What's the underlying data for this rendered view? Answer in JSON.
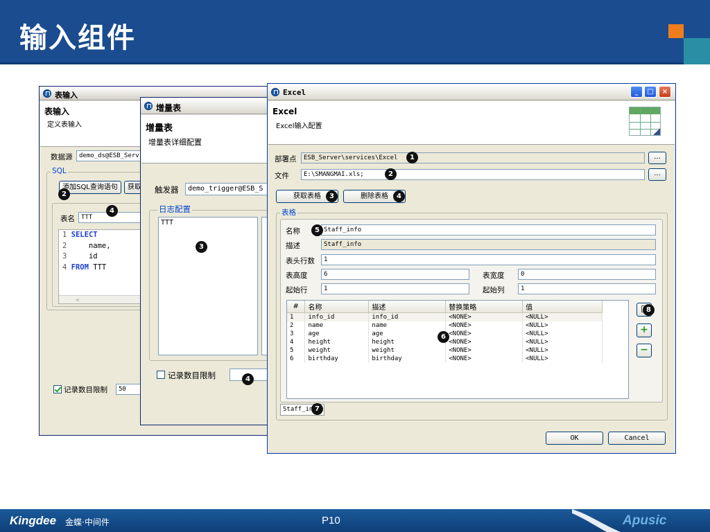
{
  "slide": {
    "title": "输入组件",
    "page": "P10",
    "footer_left_logo": "Kingdee",
    "footer_left_sub": "金蝶·中间件",
    "footer_right_logo": "Apusic"
  },
  "colors": {
    "header_bg": "#1a4c8f",
    "accent_orange": "#f07d1c",
    "accent_teal": "#2a8fa5",
    "badge": "#111111"
  },
  "table_input_window": {
    "title": "表输入",
    "header_title": "表输入",
    "header_desc": "定义表输入",
    "datasource_label": "数据源",
    "datasource_value": "demo_ds@ESB_Serv",
    "sql_group": "SQL",
    "add_sql_button": "添加SQL查询语句",
    "fetch_button": "获取",
    "table_name_label": "表名",
    "table_name_value": "TTT",
    "code_lines": [
      {
        "num": "1",
        "kw": "SELECT",
        "text": ""
      },
      {
        "num": "2",
        "kw": "",
        "text": "    name,"
      },
      {
        "num": "3",
        "kw": "",
        "text": "    id"
      },
      {
        "num": "4",
        "kw": "FROM",
        "text": " TTT"
      }
    ],
    "record_limit_label": "记录数目限制",
    "record_limit_value": "50",
    "record_limit_checked": true,
    "badges": [
      "2",
      "4"
    ]
  },
  "incremental_window": {
    "title": "增量表",
    "header_title": "增量表",
    "header_desc": "增量表详细配置",
    "trigger_label": "触发器",
    "trigger_value": "demo_trigger@ESB_S",
    "log_group": "日志配置",
    "log_value": "TTT",
    "record_limit_label": "记录数目限制",
    "record_limit_checked": false,
    "badges": [
      "3",
      "4"
    ]
  },
  "excel_window": {
    "title": "Excel",
    "header_title": "Excel",
    "header_desc": "Excel输入配置",
    "deploy_label": "部署点",
    "deploy_value": "ESB_Server\\services\\Excel",
    "file_label": "文件",
    "file_value": "E:\\SMANGMAI.xls;",
    "browse_button": "...",
    "get_sheet_button": "获取表格",
    "delete_sheet_button": "删除表格",
    "sheet_group": "表格",
    "name_label": "名称",
    "name_value": "Staff_info",
    "desc_label": "描述",
    "desc_value": "Staff_info",
    "header_rows_label": "表头行数",
    "header_rows_value": "1",
    "sheet_height_label": "表高度",
    "sheet_height_value": "6",
    "sheet_width_label": "表宽度",
    "sheet_width_value": "0",
    "start_row_label": "起始行",
    "start_row_value": "1",
    "start_col_label": "起始列",
    "start_col_value": "1",
    "columns": [
      "#",
      "名称",
      "描述",
      "替换策略",
      "值"
    ],
    "rows": [
      [
        "1",
        "info_id",
        "info_id",
        "<NONE>",
        "<NULL>"
      ],
      [
        "2",
        "name",
        "name",
        "<NONE>",
        "<NULL>"
      ],
      [
        "3",
        "age",
        "age",
        "<NONE>",
        "<NULL>"
      ],
      [
        "4",
        "height",
        "height",
        "<NONE>",
        "<NULL>"
      ],
      [
        "5",
        "weight",
        "weight",
        "<NONE>",
        "<NULL>"
      ],
      [
        "6",
        "birthday",
        "birthday",
        "<NONE>",
        "<NULL>"
      ]
    ],
    "sheet_tab": "Staff_in",
    "ok_button": "OK",
    "cancel_button": "Cancel",
    "badges": [
      "1",
      "2",
      "3",
      "4",
      "5",
      "6",
      "7",
      "8"
    ],
    "window_buttons": {
      "minimize": "_",
      "maximize": "□",
      "close": "×"
    }
  }
}
